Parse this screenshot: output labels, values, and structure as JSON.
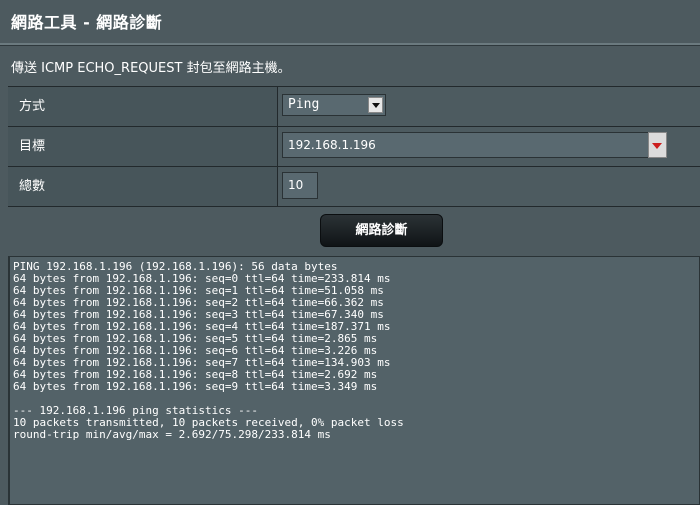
{
  "page": {
    "title": "網路工具 - 網路診斷",
    "description": "傳送 ICMP ECHO_REQUEST 封包至網路主機。"
  },
  "form": {
    "method_label": "方式",
    "method_value": "Ping",
    "target_label": "目標",
    "target_value": "192.168.1.196",
    "count_label": "總數",
    "count_value": "10"
  },
  "actions": {
    "diagnose_label": "網路診斷"
  },
  "output": {
    "lines": [
      "PING 192.168.1.196 (192.168.1.196): 56 data bytes",
      "64 bytes from 192.168.1.196: seq=0 ttl=64 time=233.814 ms",
      "64 bytes from 192.168.1.196: seq=1 ttl=64 time=51.058 ms",
      "64 bytes from 192.168.1.196: seq=2 ttl=64 time=66.362 ms",
      "64 bytes from 192.168.1.196: seq=3 ttl=64 time=67.340 ms",
      "64 bytes from 192.168.1.196: seq=4 ttl=64 time=187.371 ms",
      "64 bytes from 192.168.1.196: seq=5 ttl=64 time=2.865 ms",
      "64 bytes from 192.168.1.196: seq=6 ttl=64 time=3.226 ms",
      "64 bytes from 192.168.1.196: seq=7 ttl=64 time=134.903 ms",
      "64 bytes from 192.168.1.196: seq=8 ttl=64 time=2.692 ms",
      "64 bytes from 192.168.1.196: seq=9 ttl=64 time=3.349 ms",
      "",
      "--- 192.168.1.196 ping statistics ---",
      "10 packets transmitted, 10 packets received, 0% packet loss",
      "round-trip min/avg/max = 2.692/75.298/233.814 ms"
    ]
  }
}
